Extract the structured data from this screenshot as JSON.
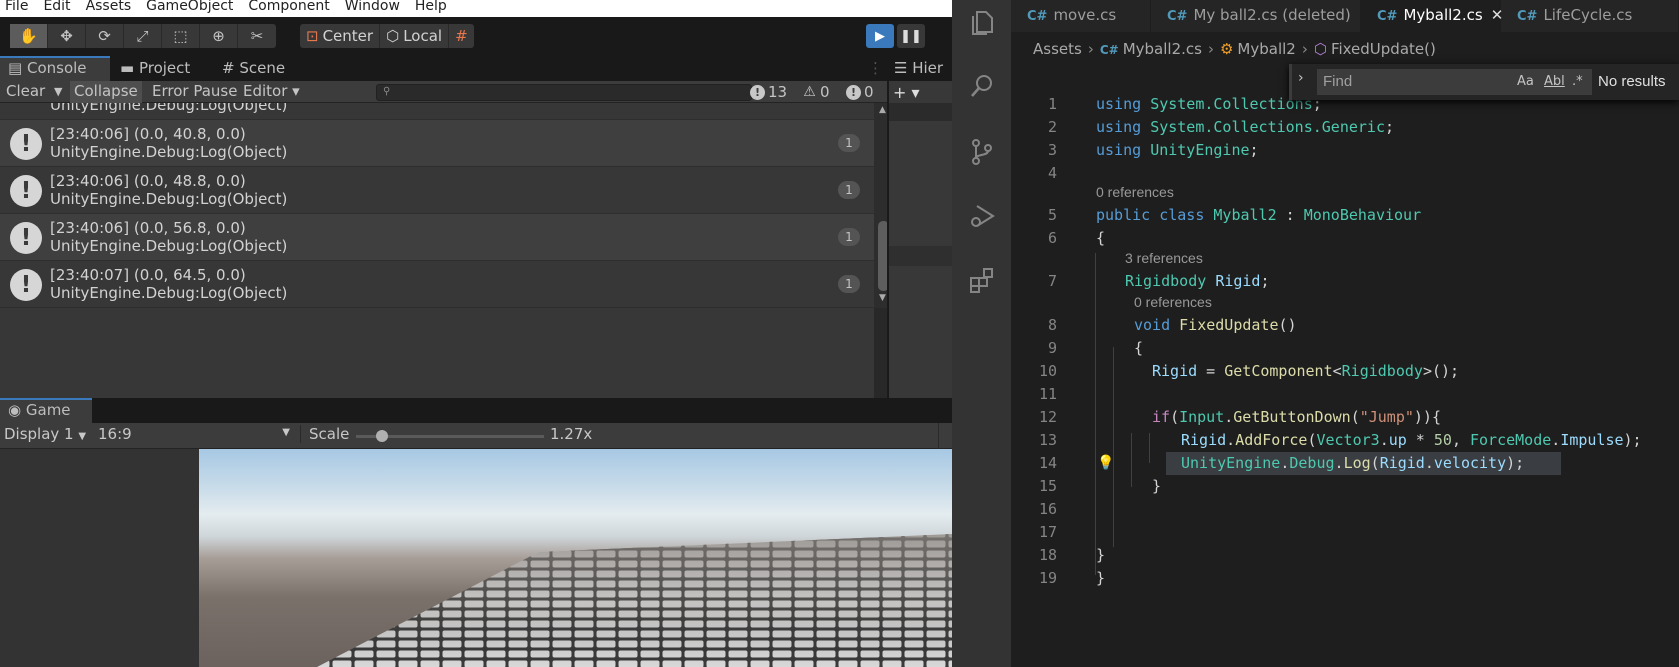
{
  "unity": {
    "menu": [
      "File",
      "Edit",
      "Assets",
      "GameObject",
      "Component",
      "Window",
      "Help"
    ],
    "toolbar": {
      "pivot": "Center",
      "space": "Local"
    },
    "tabs": {
      "console": "Console",
      "project": "Project",
      "scene": "Scene",
      "hierarchy": "Hier"
    },
    "console": {
      "clear": "Clear",
      "collapse": "Collapse",
      "error_pause": "Error Pause",
      "editor": "Editor",
      "log_count": "13",
      "warn_count": "0",
      "error_count": "0",
      "partial_top": "UnityEngine.Debug:Log(Object)",
      "rows": [
        {
          "line1": "[23:40:06] (0.0, 40.8, 0.0)",
          "line2": "UnityEngine.Debug:Log(Object)",
          "count": "1"
        },
        {
          "line1": "[23:40:06] (0.0, 48.8, 0.0)",
          "line2": "UnityEngine.Debug:Log(Object)",
          "count": "1"
        },
        {
          "line1": "[23:40:06] (0.0, 56.8, 0.0)",
          "line2": "UnityEngine.Debug:Log(Object)",
          "count": "1"
        },
        {
          "line1": "[23:40:07] (0.0, 64.5, 0.0)",
          "line2": "UnityEngine.Debug:Log(Object)",
          "count": "1"
        }
      ]
    },
    "game": {
      "tab": "Game",
      "display": "Display 1",
      "aspect": "16:9",
      "scale_label": "Scale",
      "scale_value": "1.27x",
      "scale_fraction": 0.14
    }
  },
  "vscode": {
    "tabs": [
      {
        "label": "move.cs"
      },
      {
        "label": "My ball2.cs (deleted)"
      },
      {
        "label": "Myball2.cs"
      },
      {
        "label": "LifeCycle.cs"
      }
    ],
    "breadcrumb": [
      "Assets",
      "Myball2.cs",
      "Myball2",
      "FixedUpdate()"
    ],
    "find": {
      "placeholder": "Find",
      "opt_case": "Aa",
      "opt_word": "Abl",
      "opt_regex": ".*",
      "result": "No results"
    },
    "lens": {
      "class": "0 references",
      "field": "3 references",
      "method": "0 references"
    },
    "line_numbers": [
      "1",
      "2",
      "3",
      "4",
      "5",
      "6",
      "7",
      "8",
      "9",
      "10",
      "11",
      "12",
      "13",
      "14",
      "15",
      "16",
      "17",
      "18",
      "19"
    ],
    "code": {
      "l1": [
        "using",
        "System.Collections",
        ";"
      ],
      "l2": [
        "using",
        "System.Collections.Generic",
        ";"
      ],
      "l3": [
        "using",
        "UnityEngine",
        ";"
      ],
      "l5": [
        "public",
        "class",
        "Myball2",
        ":",
        "MonoBehaviour"
      ],
      "l6": "{",
      "l7": [
        "Rigidbody",
        "Rigid",
        ";"
      ],
      "l8": [
        "void",
        "FixedUpdate",
        "()"
      ],
      "l9": "{",
      "l10": [
        "Rigid",
        " = ",
        "GetComponent",
        "<",
        "Rigidbody",
        ">();"
      ],
      "l12": [
        "if",
        "(",
        "Input",
        ".",
        "GetButtonDown",
        "(",
        "\"Jump\"",
        ")){"
      ],
      "l13": [
        "Rigid",
        ".",
        "AddForce",
        "(",
        "Vector3",
        ".",
        "up",
        " * ",
        "50",
        ", ",
        "ForceMode",
        ".",
        "Impulse",
        ");"
      ],
      "l14": [
        "UnityEngine",
        ".",
        "Debug",
        ".",
        "Log",
        "(",
        "Rigid",
        ".",
        "velocity",
        ");"
      ],
      "l15": "}",
      "l18": "}",
      "l19": "}"
    }
  }
}
